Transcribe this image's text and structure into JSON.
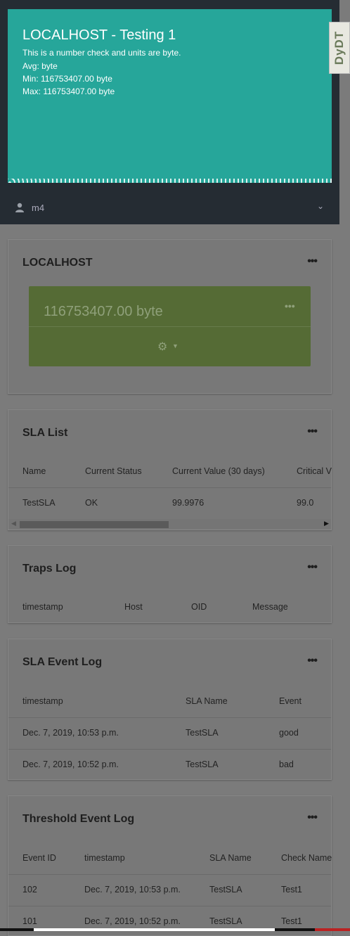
{
  "top_chart": {
    "title": "LOCALHOST - Testing 1",
    "description": "This is a number check and units are byte.",
    "avg": "Avg: byte",
    "min": "Min: 116753407.00 byte",
    "max": "Max: 116753407.00 byte",
    "color": "#26a69a"
  },
  "side_tab": {
    "label": "DyDT"
  },
  "user": {
    "name": "m4",
    "icon": "user-icon",
    "chevron": "chevron-down-icon"
  },
  "localhost_card": {
    "title": "LOCALHOST",
    "menu": "•••",
    "metric_value": "116753407.00 byte",
    "metric_menu": "•••",
    "metric_color": "#556b35",
    "settings_icon": "gear-icon"
  },
  "sla_list": {
    "title": "SLA List",
    "menu": "•••",
    "headers": [
      "Name",
      "Current Status",
      "Current Value (30 days)",
      "Critical V"
    ],
    "rows": [
      [
        "TestSLA",
        "OK",
        "99.9976",
        "99.0"
      ]
    ]
  },
  "traps_log": {
    "title": "Traps Log",
    "menu": "•••",
    "headers": [
      "timestamp",
      "Host",
      "OID",
      "Message"
    ]
  },
  "sla_event_log": {
    "title": "SLA Event Log",
    "menu": "•••",
    "headers": [
      "timestamp",
      "SLA Name",
      "Event"
    ],
    "rows": [
      [
        "Dec. 7, 2019, 10:53 p.m.",
        "TestSLA",
        "good"
      ],
      [
        "Dec. 7, 2019, 10:52 p.m.",
        "TestSLA",
        "bad"
      ]
    ]
  },
  "threshold_event_log": {
    "title": "Threshold Event Log",
    "menu": "•••",
    "headers": [
      "Event ID",
      "timestamp",
      "SLA Name",
      "Check Name"
    ],
    "rows": [
      [
        "102",
        "Dec. 7, 2019, 10:53 p.m.",
        "TestSLA",
        "Test1"
      ],
      [
        "101",
        "Dec. 7, 2019, 10:52 p.m.",
        "TestSLA",
        "Test1"
      ]
    ]
  }
}
